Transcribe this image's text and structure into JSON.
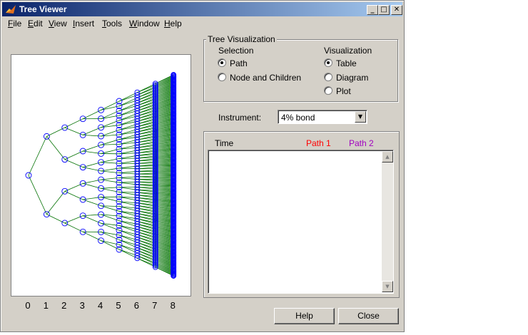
{
  "window": {
    "title": "Tree Viewer",
    "controls": {
      "minimize": "_",
      "maximize": "□",
      "close": "✕"
    }
  },
  "menu": [
    {
      "label": "File",
      "key": "F",
      "rest": "ile"
    },
    {
      "label": "Edit",
      "key": "E",
      "rest": "dit"
    },
    {
      "label": "View",
      "key": "V",
      "rest": "iew"
    },
    {
      "label": "Insert",
      "key": "I",
      "rest": "nsert"
    },
    {
      "label": "Tools",
      "key": "T",
      "rest": "ools"
    },
    {
      "label": "Window",
      "key": "W",
      "rest": "indow"
    },
    {
      "label": "Help",
      "key": "H",
      "rest": "elp"
    }
  ],
  "tree": {
    "levels": 9,
    "axis_ticks": [
      "0",
      "1",
      "2",
      "3",
      "4",
      "5",
      "6",
      "7",
      "8"
    ],
    "colors": {
      "node": "#0000ff",
      "edge": "#007000",
      "axis_text": "#000000"
    }
  },
  "visualization_group": {
    "title": "Tree Visualization",
    "selection_label": "Selection",
    "selection_options": [
      "Path",
      "Node and Children"
    ],
    "selection_selected": 0,
    "visualization_label": "Visualization",
    "visualization_options": [
      "Table",
      "Diagram",
      "Plot"
    ],
    "visualization_selected": 0
  },
  "instrument": {
    "label": "Instrument:",
    "value": "4% bond"
  },
  "table": {
    "headers": {
      "time": "Time",
      "path1": "Path 1",
      "path2": "Path 2"
    },
    "colors": {
      "path1": "#ff0000",
      "path2": "#a000c0"
    }
  },
  "buttons": {
    "help": "Help",
    "close": "Close"
  }
}
